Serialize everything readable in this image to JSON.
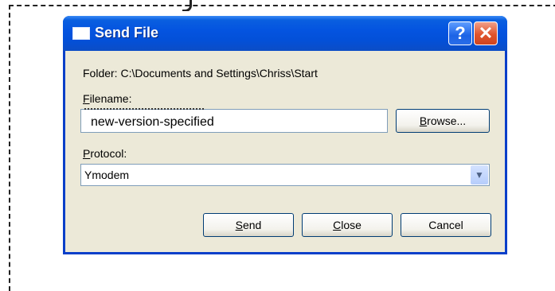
{
  "window": {
    "title": "Send File"
  },
  "titlebar": {
    "help_glyph": "?",
    "close_glyph": "✕"
  },
  "folder": {
    "label": "Folder:  C:\\Documents and Settings\\Chriss\\Start"
  },
  "filename": {
    "label_mnemonic": "F",
    "label_rest": "ilename:",
    "value": "new-version-specified"
  },
  "browse": {
    "mnemonic": "B",
    "rest": "rowse..."
  },
  "protocol": {
    "label_mnemonic": "P",
    "label_rest": "rotocol:",
    "selected": "Ymodem"
  },
  "buttons": {
    "send_mnemonic": "S",
    "send_rest": "end",
    "close_mnemonic": "C",
    "close_rest": "lose",
    "cancel": "Cancel"
  },
  "icons": [
    "window-icon",
    "help-icon",
    "close-icon",
    "chevron-down-icon"
  ],
  "colors": {
    "titlebar": "#0454e0",
    "client": "#ece9d8",
    "close_button": "#e0542c"
  }
}
